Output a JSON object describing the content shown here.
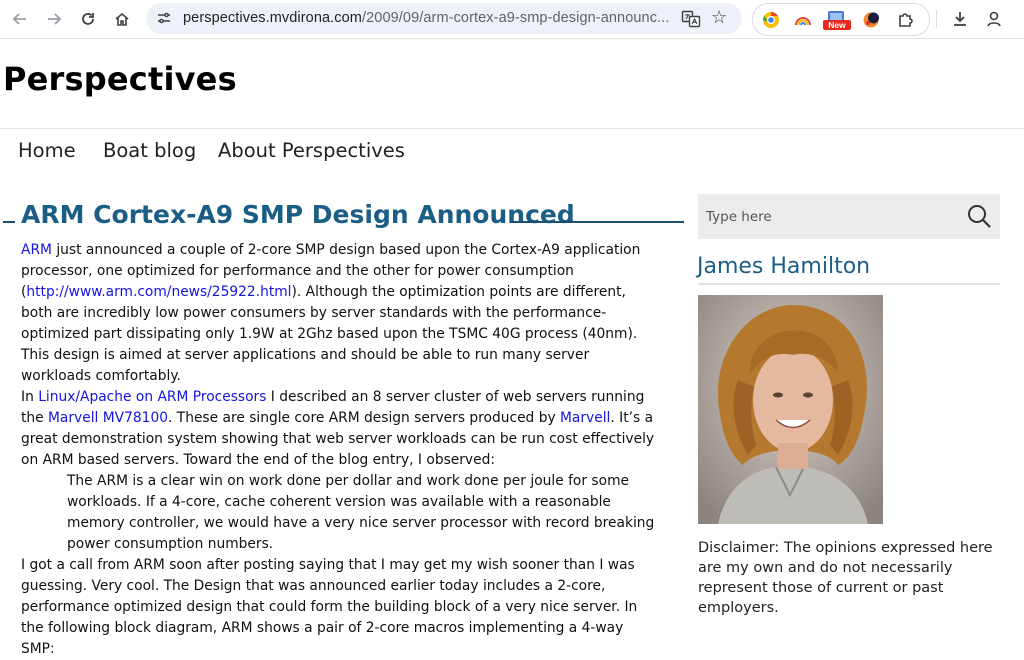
{
  "browser": {
    "url_host": "perspectives.mvdirona.com",
    "url_path": "/2009/09/arm-cortex-a9-smp-design-announc...",
    "ext_badge": "New"
  },
  "site": {
    "title": "Perspectives",
    "menu": [
      "Home",
      "Boat blog",
      "About Perspectives"
    ]
  },
  "post": {
    "title": "ARM Cortex-A9 SMP Design Announced",
    "p1_link1": "ARM",
    "p1_text1": " just announced a couple of 2-core SMP design based upon the Cortex-A9 application processor, one optimized for performance and the other for power consumption (",
    "p1_link2": "http://www.arm.com/news/25922.html",
    "p1_text2": "). Although the optimization points are different, both are incredibly low power consumers by server standards with the performance-optimized part dissipating only 1.9W at 2Ghz based upon the TSMC 40G process (40nm). This design is aimed at server applications and should be able to run many server workloads comfortably.",
    "p2_text1": "In ",
    "p2_link1": "Linux/Apache on ARM Processors",
    "p2_text2": " I described an 8 server cluster of web servers running the ",
    "p2_link2": "Marvell MV78100",
    "p2_text3": ". These are single core ARM design servers produced by ",
    "p2_link3": "Marvell",
    "p2_text4": ". It’s a great demonstration system showing that web server workloads can be run cost effectively on ARM based servers. Toward the end of the blog entry, I observed:",
    "quote": "The ARM is a clear win on work done per dollar and work done per joule for some workloads. If a 4-core, cache coherent version was available with a reasonable memory controller, we would have a very nice server processor with record breaking power consumption numbers.",
    "p3": "I got a call from ARM soon after posting saying that I may get my wish sooner than I was guessing. Very cool. The Design that was announced earlier today includes a 2-core, performance optimized design that could form the building block of a very nice server. In the following block diagram, ARM shows a pair of 2-core macros implementing a 4-way SMP:"
  },
  "sidebar": {
    "search_placeholder": "Type here",
    "author_name": "James Hamilton",
    "disclaimer": "Disclaimer: The opinions expressed here are my own and do not necessarily represent those of current or past employers."
  },
  "colors": {
    "title_blue": "#1a5e86",
    "link_blue": "#1515e0"
  }
}
